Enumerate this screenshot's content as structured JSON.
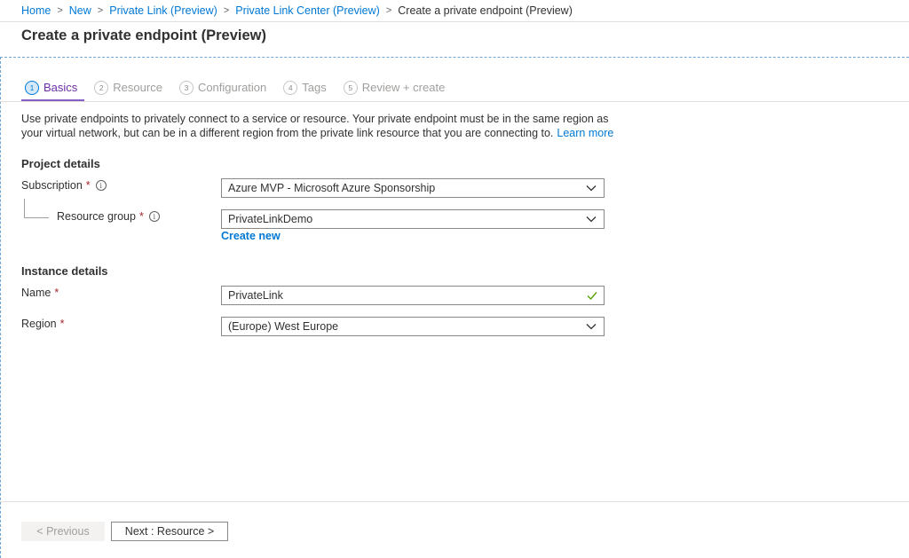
{
  "breadcrumb": {
    "items": [
      "Home",
      "New",
      "Private Link (Preview)",
      "Private Link Center (Preview)"
    ],
    "current": "Create a private endpoint (Preview)",
    "separator": ">"
  },
  "page": {
    "title": "Create a private endpoint (Preview)"
  },
  "tabs": [
    {
      "number": "1",
      "label": "Basics",
      "active": true
    },
    {
      "number": "2",
      "label": "Resource",
      "active": false
    },
    {
      "number": "3",
      "label": "Configuration",
      "active": false
    },
    {
      "number": "4",
      "label": "Tags",
      "active": false
    },
    {
      "number": "5",
      "label": "Review + create",
      "active": false
    }
  ],
  "description": {
    "text": "Use private endpoints to privately connect to a service or resource. Your private endpoint must be in the same region as your virtual network, but can be in a different region from the private link resource that you are connecting to.",
    "learn_more": "Learn more"
  },
  "project_details": {
    "heading": "Project details",
    "subscription": {
      "label": "Subscription",
      "required_mark": "*",
      "value": "Azure MVP - Microsoft Azure Sponsorship"
    },
    "resource_group": {
      "label": "Resource group",
      "required_mark": "*",
      "value": "PrivateLinkDemo",
      "create_new": "Create new"
    }
  },
  "instance_details": {
    "heading": "Instance details",
    "name": {
      "label": "Name",
      "required_mark": "*",
      "value": "PrivateLink",
      "valid": true
    },
    "region": {
      "label": "Region",
      "required_mark": "*",
      "value": "(Europe) West Europe"
    }
  },
  "footer": {
    "previous": "< Previous",
    "next": "Next : Resource >"
  },
  "icons": {
    "info": "i"
  },
  "colors": {
    "link": "#0078d4",
    "active_tab": "#6b2fa6",
    "tab_underline": "#8661c5",
    "required": "#a4262c",
    "valid_check": "#57a300"
  }
}
